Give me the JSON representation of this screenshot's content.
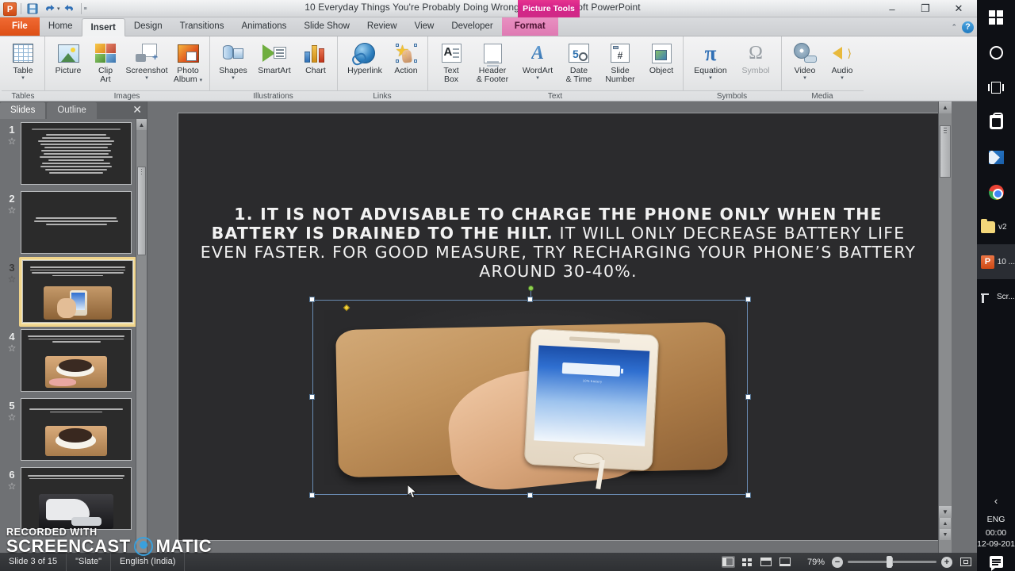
{
  "window": {
    "title": "10 Everyday Things You're Probably Doing Wrong.pptx  -  Microsoft PowerPoint",
    "context_tab_group": "Picture Tools",
    "minimize": "–",
    "restore": "❐",
    "close": "✕",
    "collapse_ribbon": "⌃",
    "help": "?"
  },
  "quick_access": {
    "app_logo": "P",
    "save": "💾",
    "undo": "↶",
    "redo": "↷",
    "customize": "≡"
  },
  "tabs": [
    {
      "label": "File",
      "kind": "file"
    },
    {
      "label": "Home",
      "kind": "normal"
    },
    {
      "label": "Insert",
      "kind": "active"
    },
    {
      "label": "Design",
      "kind": "normal"
    },
    {
      "label": "Transitions",
      "kind": "normal"
    },
    {
      "label": "Animations",
      "kind": "normal"
    },
    {
      "label": "Slide Show",
      "kind": "normal"
    },
    {
      "label": "Review",
      "kind": "normal"
    },
    {
      "label": "View",
      "kind": "normal"
    },
    {
      "label": "Developer",
      "kind": "normal"
    },
    {
      "label": "Format",
      "kind": "context"
    }
  ],
  "ribbon": {
    "groups": [
      {
        "label": "Tables",
        "items": [
          {
            "label": "Table",
            "icon": "table-icon",
            "caret": true
          }
        ]
      },
      {
        "label": "Images",
        "items": [
          {
            "label": "Picture",
            "icon": "picture-icon",
            "caret": false
          },
          {
            "label": "Clip\nArt",
            "line1": "Clip",
            "line2": "Art",
            "icon": "clip-art-icon",
            "caret": false
          },
          {
            "label": "Screenshot",
            "icon": "screenshot-icon",
            "caret": true
          },
          {
            "label": "Photo\nAlbum",
            "line1": "Photo",
            "line2": "Album",
            "icon": "photo-album-icon",
            "caret": true
          }
        ]
      },
      {
        "label": "Illustrations",
        "items": [
          {
            "label": "Shapes",
            "icon": "shapes-icon",
            "caret": true
          },
          {
            "label": "SmartArt",
            "icon": "smartart-icon",
            "caret": false
          },
          {
            "label": "Chart",
            "icon": "chart-icon",
            "caret": false
          }
        ]
      },
      {
        "label": "Links",
        "items": [
          {
            "label": "Hyperlink",
            "icon": "hyperlink-icon",
            "caret": false
          },
          {
            "label": "Action",
            "icon": "action-icon",
            "caret": false
          }
        ]
      },
      {
        "label": "Text",
        "items": [
          {
            "line1": "Text",
            "line2": "Box",
            "icon": "text-box-icon",
            "caret": false
          },
          {
            "line1": "Header",
            "line2": "& Footer",
            "icon": "header-footer-icon",
            "caret": false
          },
          {
            "label": "WordArt",
            "icon": "wordart-icon",
            "caret": true
          },
          {
            "line1": "Date",
            "line2": "& Time",
            "icon": "date-time-icon",
            "caret": false
          },
          {
            "line1": "Slide",
            "line2": "Number",
            "icon": "slide-number-icon",
            "caret": false
          },
          {
            "label": "Object",
            "icon": "object-icon",
            "caret": false
          }
        ]
      },
      {
        "label": "Symbols",
        "items": [
          {
            "label": "Equation",
            "icon": "equation-icon",
            "caret": true
          },
          {
            "label": "Symbol",
            "icon": "symbol-icon",
            "caret": false,
            "disabled": true
          }
        ]
      },
      {
        "label": "Media",
        "items": [
          {
            "label": "Video",
            "icon": "video-icon",
            "caret": true
          },
          {
            "label": "Audio",
            "icon": "audio-icon",
            "caret": true
          }
        ]
      }
    ]
  },
  "thumbpane": {
    "tabs": [
      {
        "label": "Slides",
        "active": true
      },
      {
        "label": "Outline",
        "active": false
      }
    ],
    "close": "✕",
    "slides": [
      {
        "number": "1",
        "star": "☆",
        "selected": false,
        "kind": "text",
        "lines": 13
      },
      {
        "number": "2",
        "star": "☆",
        "selected": false,
        "kind": "text-center",
        "lines": 3
      },
      {
        "number": "3",
        "star": "☆",
        "selected": true,
        "kind": "photo",
        "lines": 4
      },
      {
        "number": "4",
        "star": "☆",
        "selected": false,
        "kind": "photo",
        "lines": 3
      },
      {
        "number": "5",
        "star": "☆",
        "selected": false,
        "kind": "photo",
        "lines": 2
      },
      {
        "number": "6",
        "star": "☆",
        "selected": false,
        "kind": "photo",
        "lines": 2
      }
    ]
  },
  "slide": {
    "text_bold": "1. IT IS NOT ADVISABLE TO CHARGE THE PHONE ONLY WHEN THE BATTERY IS DRAINED TO THE HILT.",
    "text_normal": " IT WILL ONLY DECREASE BATTERY LIFE EVEN FASTER. FOR GOOD MEASURE, TRY RECHARGING YOUR PHONE’S BATTERY AROUND 30-40%.",
    "picture_caption": "hand holding gold iPhone charging on wooden board",
    "phone_screen_text": "10% battery"
  },
  "statusbar": {
    "slide_counter": "Slide 3 of 15",
    "theme": "\"Slate\"",
    "language": "English (India)",
    "views": [
      {
        "name": "normal-view",
        "active": true
      },
      {
        "name": "slide-sorter-view",
        "active": false
      },
      {
        "name": "reading-view",
        "active": false
      },
      {
        "name": "slide-show-view",
        "active": false
      }
    ],
    "zoom": "79%",
    "zoom_out": "−",
    "zoom_in": "+",
    "fit_to_window": "fit-slide-to-window"
  },
  "watermark": {
    "recorded_with": "RECORDED WITH",
    "brand_left": "SCREENCAST",
    "brand_right": "MATIC"
  },
  "taskbar": {
    "items": [
      {
        "name": "start-button",
        "icon": "windows-logo-icon",
        "label": ""
      },
      {
        "name": "cortana-search",
        "icon": "cortana-circle-icon",
        "label": ""
      },
      {
        "name": "task-view",
        "icon": "task-view-icon",
        "label": ""
      },
      {
        "name": "microsoft-store",
        "icon": "store-icon",
        "label": ""
      },
      {
        "name": "mail-app",
        "icon": "mail-icon",
        "label": ""
      },
      {
        "name": "google-chrome",
        "icon": "chrome-icon",
        "label": ""
      },
      {
        "name": "explorer-window-v2",
        "icon": "folder-icon",
        "label": "v2"
      },
      {
        "name": "powerpoint-window",
        "icon": "powerpoint-icon",
        "label": "10 ..."
      },
      {
        "name": "screencast-window",
        "icon": "screencast-icon",
        "label": "Scr..."
      }
    ],
    "tray": {
      "chevron": "‹",
      "language": "ENG",
      "time": "00:00",
      "date": "12-09-201",
      "action_center": "action-center-icon"
    }
  }
}
